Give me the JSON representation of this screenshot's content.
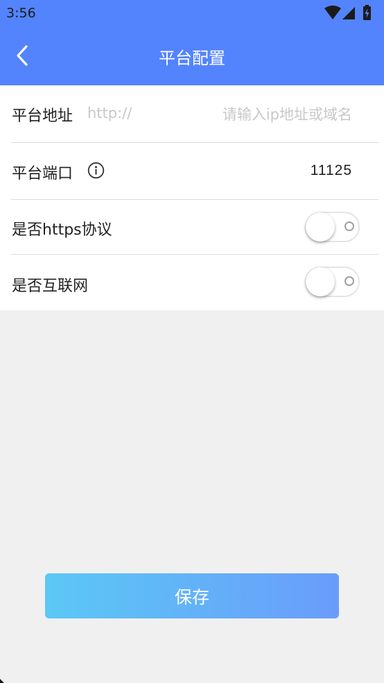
{
  "status_bar": {
    "time": "3:56",
    "icons": [
      "wifi-icon",
      "signal-icon",
      "battery-charging-icon"
    ]
  },
  "app_bar": {
    "title": "平台配置",
    "back_icon": "chevron-left-icon"
  },
  "form": {
    "address": {
      "label": "平台地址",
      "prefix": "http://",
      "value": "",
      "placeholder": "请输入ip地址或域名"
    },
    "port": {
      "label": "平台端口",
      "info_icon": "info-icon",
      "value": "11125"
    },
    "https": {
      "label": "是否https协议",
      "enabled": false
    },
    "internet": {
      "label": "是否互联网",
      "enabled": false
    }
  },
  "actions": {
    "save_label": "保存"
  },
  "colors": {
    "primary": "#5384fd",
    "gradient_start": "#5bc8f5",
    "gradient_end": "#6a9cfb",
    "background": "#f0f0f0"
  }
}
